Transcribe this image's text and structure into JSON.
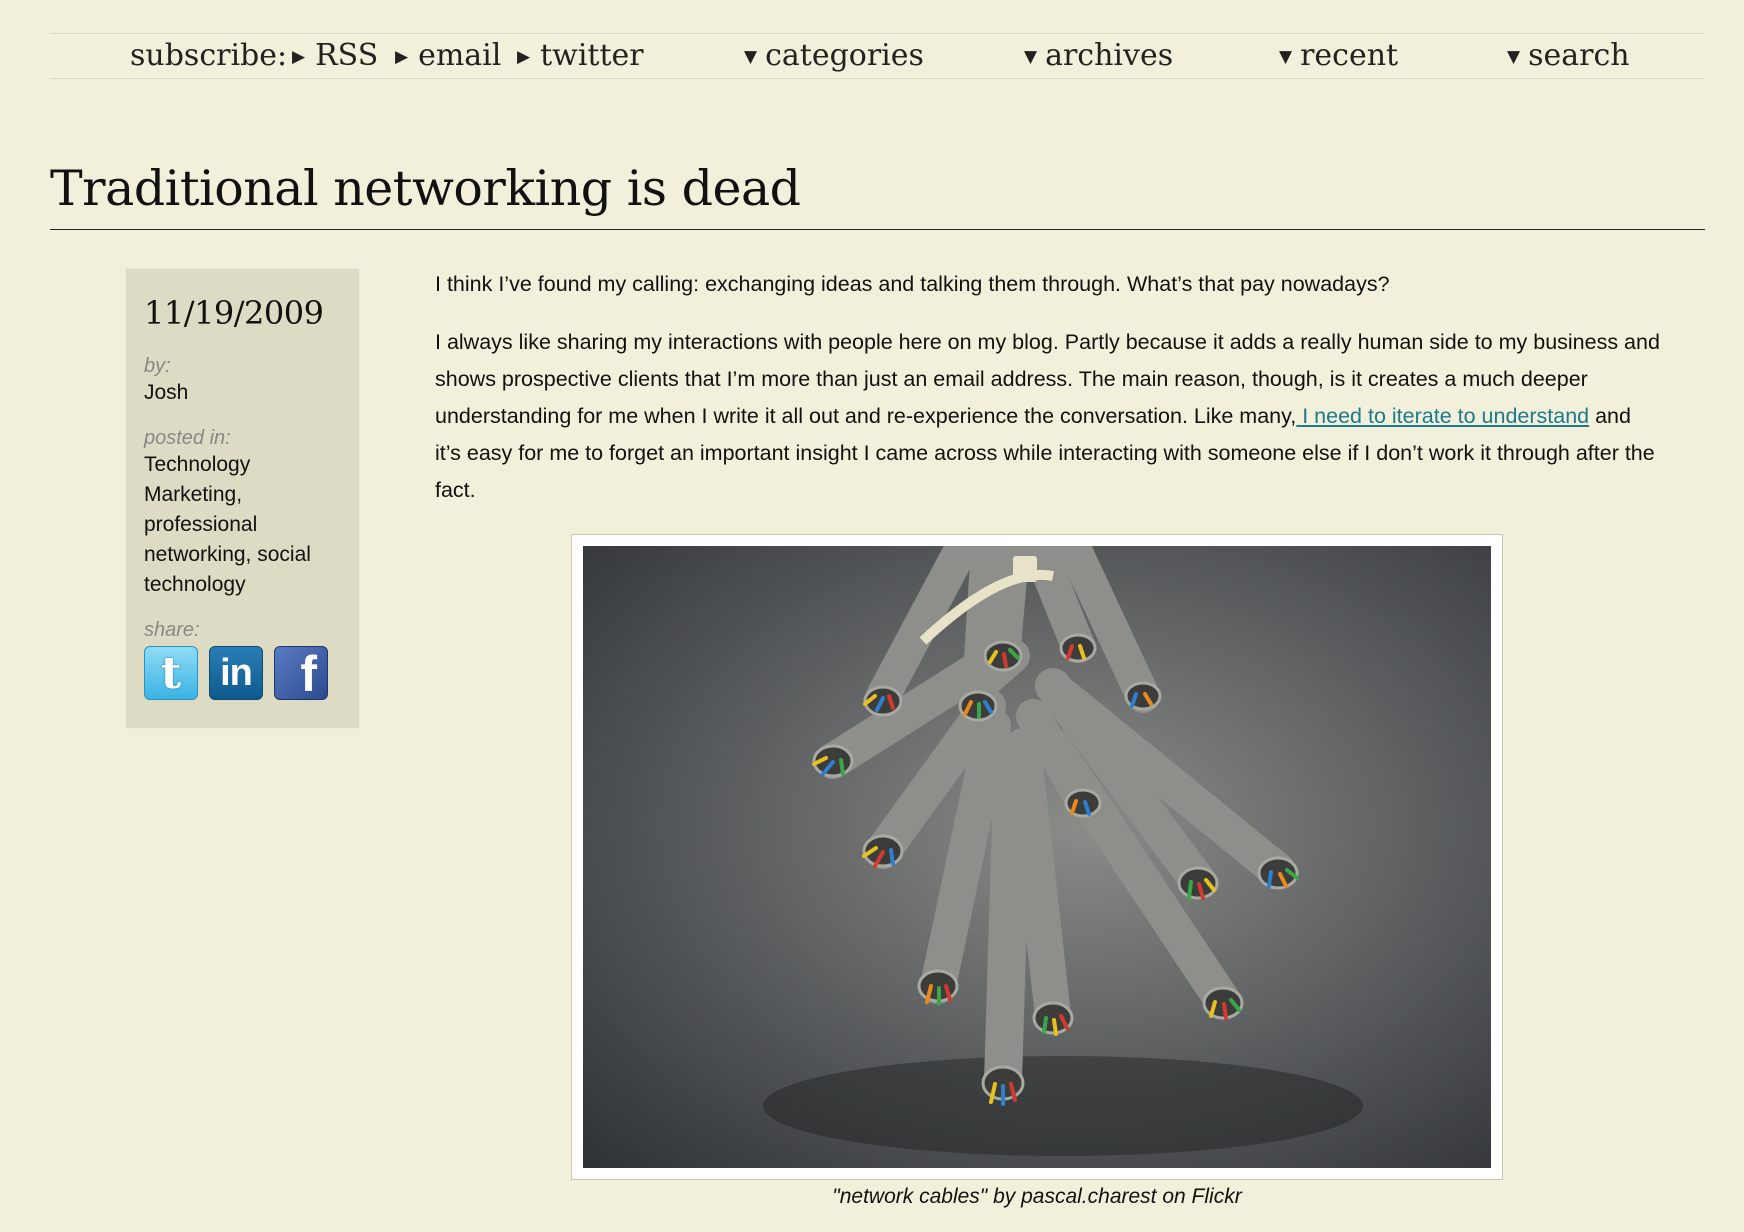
{
  "nav": {
    "subscribe_label": "subscribe:",
    "rss": "RSS",
    "email": "email",
    "twitter": "twitter",
    "categories": "categories",
    "archives": "archives",
    "recent": "recent",
    "search": "search"
  },
  "post": {
    "title": "Traditional networking is dead",
    "date": "11/19/2009",
    "by_label": "by:",
    "author": "Josh",
    "posted_in_label": "posted in:",
    "categories": "Technology Marketing, professional networking, social technology",
    "share_label": "share:",
    "share_icons": [
      "twitter-icon",
      "linkedin-icon",
      "facebook-icon"
    ],
    "paragraph1": "I think I’ve found my calling: exchanging ideas and talking them through. What’s that pay nowadays?",
    "paragraph2_before": "I always like sharing my interactions with people here on my blog. Partly because it adds a really human side to my business and shows prospective clients that I’m more than just an email address. The main reason, though, is it creates a much deeper understanding for me when I write it all out and re-experience the conversation. Like many,",
    "paragraph2_link": " I need to iterate to understand",
    "paragraph2_after": " and it’s easy for me to forget an important insight I came across while interacting with someone else if I don’t work it through after the fact.",
    "image_caption": "\"network cables\" by pascal.charest on Flickr"
  },
  "colors": {
    "background": "#f2f0da",
    "sidebar": "#dddbc3",
    "link": "#1c7a8c"
  }
}
